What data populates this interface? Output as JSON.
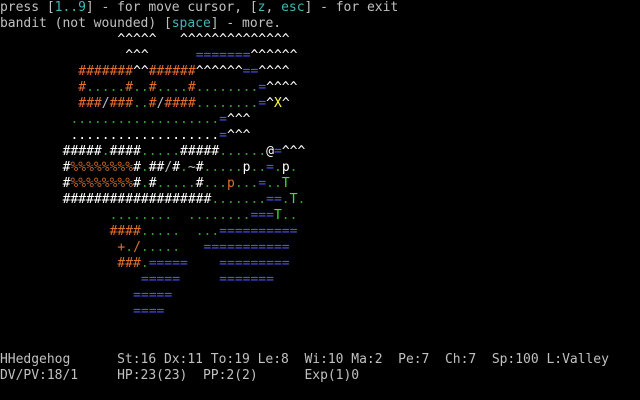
{
  "messages": {
    "line1": [
      {
        "t": "press [",
        "c": "gray"
      },
      {
        "t": "1..9",
        "c": "cyan"
      },
      {
        "t": "] - for move cursor, [",
        "c": "gray"
      },
      {
        "t": "z",
        "c": "cyan"
      },
      {
        "t": ", ",
        "c": "gray"
      },
      {
        "t": "esc",
        "c": "cyan"
      },
      {
        "t": "] - for exit",
        "c": "gray"
      }
    ],
    "line2": [
      {
        "t": "bandit (not wounded) [",
        "c": "gray"
      },
      {
        "t": "space",
        "c": "cyan"
      },
      {
        "t": "] - more.",
        "c": "gray"
      }
    ]
  },
  "map": [
    [
      {
        "t": "               ",
        "c": "gray"
      },
      {
        "t": "^^^^^",
        "c": "white"
      },
      {
        "t": "   ",
        "c": "gray"
      },
      {
        "t": "^^^^^^^^^^^^^^",
        "c": "white"
      }
    ],
    [
      {
        "t": "                ",
        "c": "gray"
      },
      {
        "t": "^^^",
        "c": "white"
      },
      {
        "t": "      ",
        "c": "gray"
      },
      {
        "t": "=======",
        "c": "blue"
      },
      {
        "t": "^^^^^^",
        "c": "white"
      }
    ],
    [
      {
        "t": "          ",
        "c": "gray"
      },
      {
        "t": "#######",
        "c": "orange"
      },
      {
        "t": "^^",
        "c": "white"
      },
      {
        "t": "######",
        "c": "orange"
      },
      {
        "t": "^^^^^^",
        "c": "white"
      },
      {
        "t": "==",
        "c": "blue"
      },
      {
        "t": "^^^^",
        "c": "white"
      }
    ],
    [
      {
        "t": "          ",
        "c": "gray"
      },
      {
        "t": "#",
        "c": "orange"
      },
      {
        "t": ".....",
        "c": "green"
      },
      {
        "t": "#",
        "c": "orange"
      },
      {
        "t": "..",
        "c": "green"
      },
      {
        "t": "#",
        "c": "orange"
      },
      {
        "t": "....",
        "c": "green"
      },
      {
        "t": "#",
        "c": "orange"
      },
      {
        "t": "........",
        "c": "green"
      },
      {
        "t": "=",
        "c": "blue"
      },
      {
        "t": "^^^^",
        "c": "white"
      }
    ],
    [
      {
        "t": "          ",
        "c": "gray"
      },
      {
        "t": "###",
        "c": "orange"
      },
      {
        "t": "/",
        "c": "gray"
      },
      {
        "t": "###",
        "c": "orange"
      },
      {
        "t": "..",
        "c": "green"
      },
      {
        "t": "#",
        "c": "orange"
      },
      {
        "t": "/",
        "c": "gray"
      },
      {
        "t": "####",
        "c": "orange"
      },
      {
        "t": "........",
        "c": "green"
      },
      {
        "t": "=",
        "c": "blue"
      },
      {
        "t": "^",
        "c": "white"
      },
      {
        "t": "X",
        "c": "yellow"
      },
      {
        "t": "^",
        "c": "white"
      }
    ],
    [
      {
        "t": "         ",
        "c": "gray"
      },
      {
        "t": "...................",
        "c": "green"
      },
      {
        "t": "=",
        "c": "blue"
      },
      {
        "t": "^^^",
        "c": "white"
      }
    ],
    [
      {
        "t": "         ",
        "c": "gray"
      },
      {
        "t": "...................",
        "c": "white"
      },
      {
        "t": "=",
        "c": "blue"
      },
      {
        "t": "^^^",
        "c": "white"
      }
    ],
    [
      {
        "t": "        ",
        "c": "gray"
      },
      {
        "t": "#####",
        "c": "white"
      },
      {
        "t": ".",
        "c": "green"
      },
      {
        "t": "####",
        "c": "white"
      },
      {
        "t": ".....",
        "c": "green"
      },
      {
        "t": "#####",
        "c": "white"
      },
      {
        "t": "......",
        "c": "green"
      },
      {
        "t": "@",
        "c": "white"
      },
      {
        "t": "=",
        "c": "blue"
      },
      {
        "t": "^^^",
        "c": "white"
      }
    ],
    [
      {
        "t": "        ",
        "c": "gray"
      },
      {
        "t": "#",
        "c": "white"
      },
      {
        "t": "%%%%%%%%",
        "c": "brown"
      },
      {
        "t": "#",
        "c": "white"
      },
      {
        "t": ".",
        "c": "green"
      },
      {
        "t": "##",
        "c": "white"
      },
      {
        "t": "/",
        "c": "gray"
      },
      {
        "t": "#",
        "c": "white"
      },
      {
        "t": ".",
        "c": "green"
      },
      {
        "t": "~",
        "c": "gray"
      },
      {
        "t": "#",
        "c": "white"
      },
      {
        "t": ".....",
        "c": "green"
      },
      {
        "t": "p",
        "c": "white"
      },
      {
        "t": "..",
        "c": "green"
      },
      {
        "t": "=",
        "c": "blue"
      },
      {
        "t": ".",
        "c": "green"
      },
      {
        "t": "p",
        "c": "white"
      },
      {
        "t": ".",
        "c": "green"
      }
    ],
    [
      {
        "t": "        ",
        "c": "gray"
      },
      {
        "t": "#",
        "c": "white"
      },
      {
        "t": "%%%%%%%%",
        "c": "brown"
      },
      {
        "t": "#",
        "c": "white"
      },
      {
        "t": ".",
        "c": "green"
      },
      {
        "t": "#",
        "c": "white"
      },
      {
        "t": ".....",
        "c": "green"
      },
      {
        "t": "#",
        "c": "white"
      },
      {
        "t": "...",
        "c": "green"
      },
      {
        "t": "p",
        "c": "orange"
      },
      {
        "t": "...",
        "c": "green"
      },
      {
        "t": "=",
        "c": "blue"
      },
      {
        "t": "..",
        "c": "green"
      },
      {
        "t": "T",
        "c": "lgreen"
      }
    ],
    [
      {
        "t": "        ",
        "c": "gray"
      },
      {
        "t": "###################",
        "c": "white"
      },
      {
        "t": ".......",
        "c": "green"
      },
      {
        "t": "==",
        "c": "blue"
      },
      {
        "t": ".",
        "c": "green"
      },
      {
        "t": "T",
        "c": "lgreen"
      },
      {
        "t": ".",
        "c": "green"
      }
    ],
    [
      {
        "t": "              ",
        "c": "gray"
      },
      {
        "t": "........",
        "c": "green"
      },
      {
        "t": "  ",
        "c": "gray"
      },
      {
        "t": "........",
        "c": "green"
      },
      {
        "t": "===",
        "c": "blue"
      },
      {
        "t": "T",
        "c": "lgreen"
      },
      {
        "t": "..",
        "c": "green"
      }
    ],
    [
      {
        "t": "              ",
        "c": "gray"
      },
      {
        "t": "####",
        "c": "orange"
      },
      {
        "t": ".....",
        "c": "green"
      },
      {
        "t": "  ",
        "c": "gray"
      },
      {
        "t": "...",
        "c": "green"
      },
      {
        "t": "==========",
        "c": "blue"
      }
    ],
    [
      {
        "t": "               ",
        "c": "gray"
      },
      {
        "t": "+",
        "c": "orange"
      },
      {
        "t": ".",
        "c": "green"
      },
      {
        "t": "/",
        "c": "orange"
      },
      {
        "t": ".....",
        "c": "green"
      },
      {
        "t": "   ",
        "c": "gray"
      },
      {
        "t": "===========",
        "c": "blue"
      }
    ],
    [
      {
        "t": "               ",
        "c": "gray"
      },
      {
        "t": "###",
        "c": "orange"
      },
      {
        "t": ".",
        "c": "green"
      },
      {
        "t": "=====",
        "c": "blue"
      },
      {
        "t": "    ",
        "c": "gray"
      },
      {
        "t": "=========",
        "c": "blue"
      }
    ],
    [
      {
        "t": "                  ",
        "c": "gray"
      },
      {
        "t": "=====",
        "c": "blue"
      },
      {
        "t": "     ",
        "c": "gray"
      },
      {
        "t": "=======",
        "c": "blue"
      }
    ],
    [
      {
        "t": "                 ",
        "c": "gray"
      },
      {
        "t": "=====",
        "c": "blue"
      }
    ],
    [
      {
        "t": "                 ",
        "c": "gray"
      },
      {
        "t": "====",
        "c": "blue"
      }
    ]
  ],
  "status": {
    "line1": "HHedgehog      St:16 Dx:11 To:19 Le:8  Wi:10 Ma:2  Pe:7  Ch:7  Sp:100 L:Valley",
    "line2": "DV/PV:18/1     HP:23(23)  PP:2(2)      Exp(1)0"
  },
  "colors": {
    "background": "#000000",
    "text": "#c0c0c0",
    "key_highlight": "#3fb8b8",
    "cursor": "#ffff40"
  }
}
